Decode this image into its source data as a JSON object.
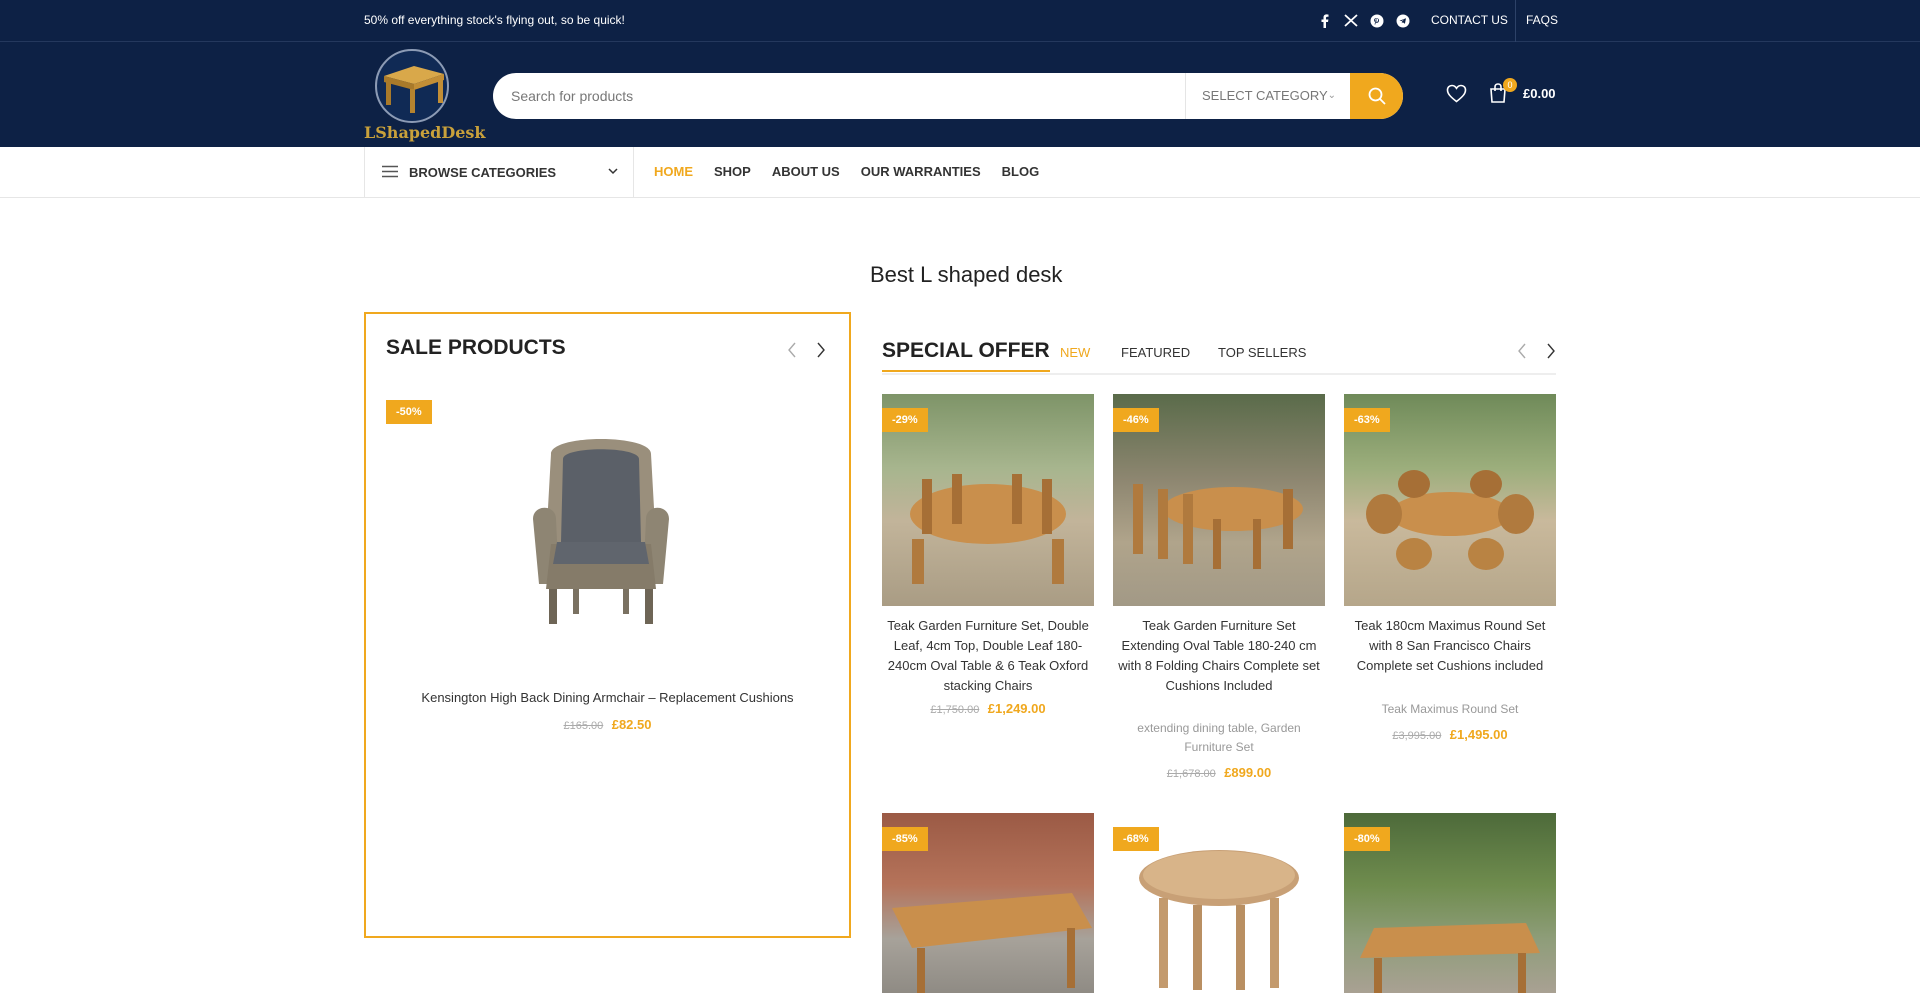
{
  "topbar": {
    "promo": "50% off everything  stock's flying out, so be quick!",
    "social_icons": [
      "facebook-icon",
      "x-icon",
      "pinterest-icon",
      "telegram-icon"
    ],
    "contact": "CONTACT US",
    "faqs": "FAQS"
  },
  "header": {
    "logo_text": "LShapedDesk",
    "search_placeholder": "Search for products",
    "category_label": "SELECT CATEGORY",
    "cart_count": "0",
    "cart_total": "£0.00"
  },
  "nav": {
    "browse_label": "BROWSE CATEGORIES",
    "items": [
      "HOME",
      "SHOP",
      "ABOUT US",
      "OUR WARRANTIES",
      "BLOG"
    ],
    "active": "HOME"
  },
  "page": {
    "title": "Best L shaped desk"
  },
  "sale": {
    "heading": "SALE PRODUCTS",
    "product": {
      "badge": "-50%",
      "name": "Kensington High Back Dining Armchair – Replacement Cushions",
      "old_price": "£165.00",
      "new_price": "£82.50"
    }
  },
  "offer": {
    "title": "SPECIAL OFFER",
    "tabs": [
      "NEW",
      "FEATURED",
      "TOP SELLERS"
    ],
    "products": [
      {
        "badge": "-29%",
        "name": "Teak Garden Furniture Set, Double Leaf, 4cm Top, Double Leaf 180-240cm Oval Table & 6 Teak Oxford stacking Chairs",
        "categories": "",
        "old_price": "£1,750.00",
        "new_price": "£1,249.00"
      },
      {
        "badge": "-46%",
        "name": "Teak Garden Furniture Set Extending Oval Table 180-240 cm with 8 Folding Chairs Complete set Cushions Included",
        "categories": "extending dining table, Garden Furniture Set",
        "old_price": "£1,678.00",
        "new_price": "£899.00"
      },
      {
        "badge": "-63%",
        "name": "Teak 180cm Maximus Round Set with 8 San Francisco Chairs Complete set Cushions included",
        "categories": "Teak Maximus Round Set",
        "old_price": "£3,995.00",
        "new_price": "£1,495.00"
      },
      {
        "badge": "-85%"
      },
      {
        "badge": "-68%"
      },
      {
        "badge": "-80%"
      }
    ]
  },
  "colors": {
    "navy": "#0d2145",
    "accent": "#f0a81e"
  }
}
